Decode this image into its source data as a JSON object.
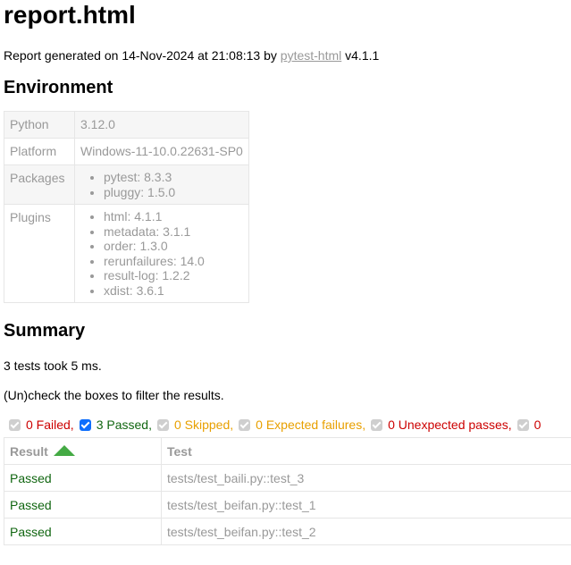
{
  "title": "report.html",
  "generated": {
    "prefix": "Report generated on 14-Nov-2024 at 21:08:13 by ",
    "link": "pytest-html",
    "suffix": " v4.1.1"
  },
  "environment": {
    "heading": "Environment",
    "python": {
      "key": "Python",
      "value": "3.12.0"
    },
    "platform": {
      "key": "Platform",
      "value": "Windows-11-10.0.22631-SP0"
    },
    "packages": {
      "key": "Packages",
      "items": [
        "pytest: 8.3.3",
        "pluggy: 1.5.0"
      ]
    },
    "plugins": {
      "key": "Plugins",
      "items": [
        "html: 4.1.1",
        "metadata: 3.1.1",
        "order: 1.3.0",
        "rerunfailures: 14.0",
        "result-log: 1.2.2",
        "xdist: 3.6.1"
      ]
    }
  },
  "summary": {
    "heading": "Summary",
    "took": "3 tests took 5 ms.",
    "filter_hint": "(Un)check the boxes to filter the results.",
    "filters": {
      "failed": "0 Failed,",
      "passed": "3 Passed,",
      "skipped": "0 Skipped,",
      "xfailed": "0 Expected failures,",
      "xpassed": "0 Unexpected passes,",
      "errors": "0"
    }
  },
  "results": {
    "col_result": "Result",
    "col_test": "Test",
    "rows": [
      {
        "result": "Passed",
        "test": "tests/test_baili.py::test_3"
      },
      {
        "result": "Passed",
        "test": "tests/test_beifan.py::test_1"
      },
      {
        "result": "Passed",
        "test": "tests/test_beifan.py::test_2"
      }
    ]
  },
  "colors": {
    "passed": "#116611",
    "failed": "#cc0000",
    "skipped": "#e8a000",
    "checkbox_checked": "#0d6efd"
  }
}
